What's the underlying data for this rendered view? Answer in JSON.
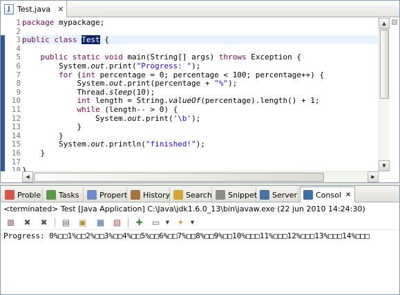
{
  "editor": {
    "tab": {
      "icon": "java-file-icon",
      "label": "Test.java",
      "close": "✕"
    },
    "line_numbers": [
      "1",
      "2",
      "3",
      "4",
      "5",
      "6",
      "7",
      "8",
      "9",
      "10",
      "11",
      "12",
      "13",
      "14",
      "15",
      "16",
      "17",
      "18"
    ],
    "code": {
      "l1": {
        "kw": "package",
        "rest": " mypackage;"
      },
      "l3": {
        "kw1": "public",
        "kw2": "class",
        "name": "Test",
        "rest": " {"
      },
      "l5": {
        "kw1": "public",
        "kw2": "static",
        "kw3": "void",
        "mid": " main(String[] args) ",
        "kw4": "throws",
        "rest": " Exception {"
      },
      "l6": {
        "a": "System.",
        "out": "out",
        "b": ".print(",
        "str": "\"Progress: \"",
        "c": ");"
      },
      "l7": {
        "kw1": "for",
        "a": " (",
        "kw2": "int",
        "rest": " percentage = 0; percentage < 100; percentage++) {"
      },
      "l8": {
        "a": "System.",
        "out": "out",
        "b": ".print(percentage + ",
        "str": "\"%\"",
        "c": ");"
      },
      "l9": {
        "a": "Thread.",
        "sleep": "sleep",
        "b": "(10);"
      },
      "l10": {
        "kw": "int",
        "a": " length = String.",
        "valueOf": "valueOf",
        "b": "(percentage).length() + 1;"
      },
      "l11": {
        "kw": "while",
        "rest": " (length-- > 0) {"
      },
      "l12": {
        "a": "System.",
        "out": "out",
        "b": ".print(",
        "str": "'\\b'",
        "c": ");"
      },
      "l13": {
        "text": "}"
      },
      "l14": {
        "text": "}"
      },
      "l15": {
        "a": "System.",
        "out": "out",
        "b": ".println(",
        "str": "\"finished!\"",
        "c": ");"
      },
      "l16": {
        "text": "}"
      },
      "l18": {
        "text": "}"
      }
    }
  },
  "views": {
    "tabs": [
      {
        "label": "Proble",
        "icon": "problems-icon",
        "color": "#d9534f"
      },
      {
        "label": "Tasks",
        "icon": "tasks-icon",
        "color": "#5a9b4a"
      },
      {
        "label": "Propert",
        "icon": "properties-icon",
        "color": "#6b8cc7"
      },
      {
        "label": "History",
        "icon": "history-icon",
        "color": "#a3763f"
      },
      {
        "label": "Search",
        "icon": "search-icon",
        "color": "#d2a63b"
      },
      {
        "label": "Snippet",
        "icon": "snippet-icon",
        "color": "#8a8a8a"
      },
      {
        "label": "Server",
        "icon": "server-icon",
        "color": "#4a6fa5"
      },
      {
        "label": "Consol",
        "icon": "console-icon",
        "color": "#3a6ea5"
      }
    ],
    "console_close": "✕"
  },
  "console": {
    "status": "<terminated> Test [Java Application] C:\\Java\\jdk1.6.0_13\\bin\\javaw.exe (22 jun 2010 14:24:30)",
    "output": "Progress: 0%□□1%□□2%□□3%□□4%□□5%□□6%□□7%□□8%□□9%□□10%□□□11%□□□12%□□□13%□□□14%□□□"
  },
  "colors": {
    "keyword": "#7f0055",
    "string": "#2a00ff",
    "selection": "#0a246a",
    "current_line": "#e8f2fe"
  }
}
